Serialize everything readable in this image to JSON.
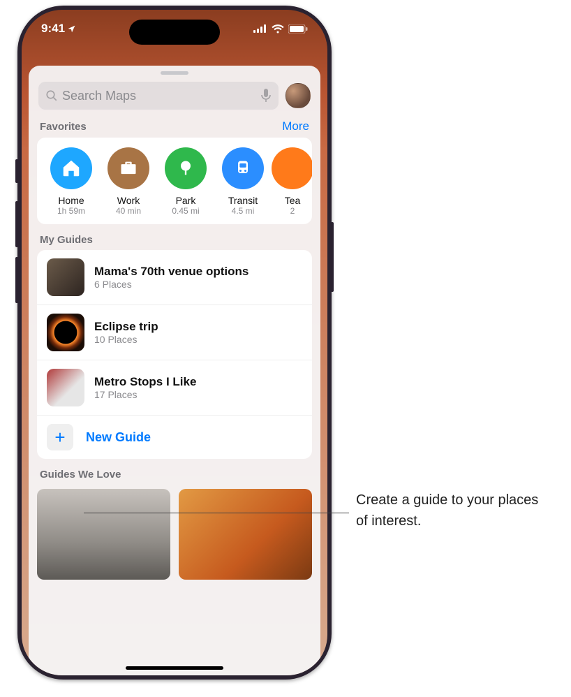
{
  "status": {
    "time": "9:41",
    "location_arrow": "➤"
  },
  "search": {
    "placeholder": "Search Maps"
  },
  "sections": {
    "favorites": {
      "title": "Favorites",
      "more": "More"
    },
    "my_guides": {
      "title": "My Guides"
    },
    "guides_we_love": {
      "title": "Guides We Love"
    }
  },
  "favorites": [
    {
      "name": "Home",
      "sub": "1h 59m"
    },
    {
      "name": "Work",
      "sub": "40 min"
    },
    {
      "name": "Park",
      "sub": "0.45 mi"
    },
    {
      "name": "Transit",
      "sub": "4.5 mi"
    },
    {
      "name": "Tea",
      "sub": "2"
    }
  ],
  "guides": [
    {
      "title": "Mama's 70th venue options",
      "subtitle": "6 Places"
    },
    {
      "title": "Eclipse trip",
      "subtitle": "10 Places"
    },
    {
      "title": "Metro Stops I Like",
      "subtitle": "17 Places"
    }
  ],
  "new_guide": {
    "label": "New Guide"
  },
  "callout": {
    "text": "Create a guide to your places of interest."
  },
  "colors": {
    "accent": "#007aff"
  }
}
